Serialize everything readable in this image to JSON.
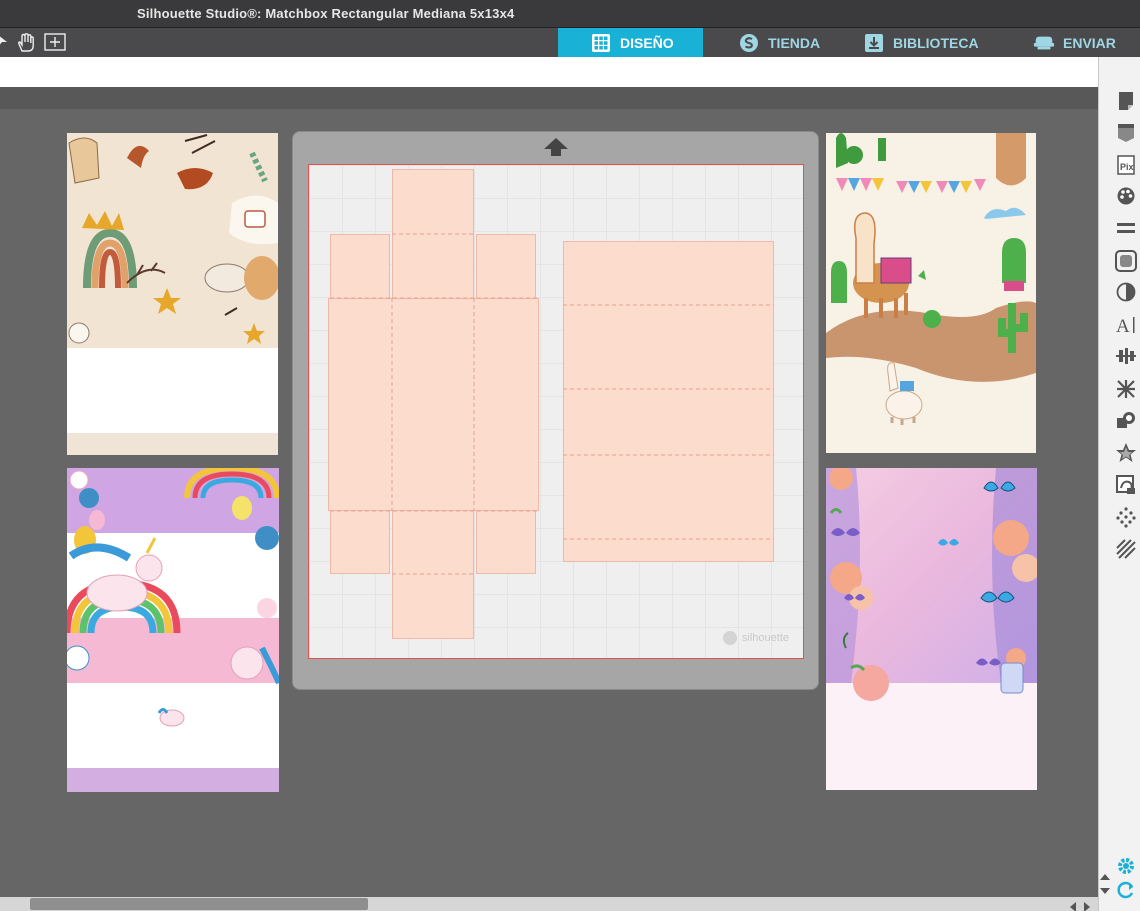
{
  "window": {
    "title": "Silhouette Studio®: Matchbox Rectangular Mediana 5x13x4"
  },
  "toolbar": {
    "icons": [
      "select-arrow-icon",
      "hand-pan-icon",
      "zoom-fit-icon"
    ]
  },
  "tabs": [
    {
      "label": "DISEÑO",
      "icon": "grid-icon",
      "active": true
    },
    {
      "label": "TIENDA",
      "icon": "silhouette-s-icon",
      "active": false
    },
    {
      "label": "BIBLIOTECA",
      "icon": "library-download-icon",
      "active": false
    },
    {
      "label": "ENVIAR",
      "icon": "cutter-machine-icon",
      "active": false
    }
  ],
  "colors": {
    "accent": "#19b1d6",
    "piece_fill": "#fcdccd",
    "cut_line": "#e0524f",
    "workspace": "#666666"
  },
  "mat": {
    "brand_label": "silhouette"
  },
  "cards": [
    {
      "name": "boho-card",
      "theme": "boho-rainbow"
    },
    {
      "name": "unicorn-card",
      "theme": "unicorn-rainbow"
    },
    {
      "name": "llama-card",
      "theme": "llama-cactus"
    },
    {
      "name": "butterfly-card",
      "theme": "butterfly-floral"
    }
  ],
  "side_panel": {
    "icons": [
      "page-setup-icon",
      "registration-marks-icon",
      "pixscan-icon",
      "fill-color-icon",
      "line-style-icon",
      "image-effects-icon",
      "transparency-icon",
      "text-style-icon",
      "align-icon",
      "replicate-icon",
      "modify-icon",
      "offset-icon",
      "trace-icon",
      "rhinestone-icon",
      "sketch-icon"
    ],
    "bottom_icons": [
      "settings-gear-icon",
      "sync-icon"
    ]
  }
}
